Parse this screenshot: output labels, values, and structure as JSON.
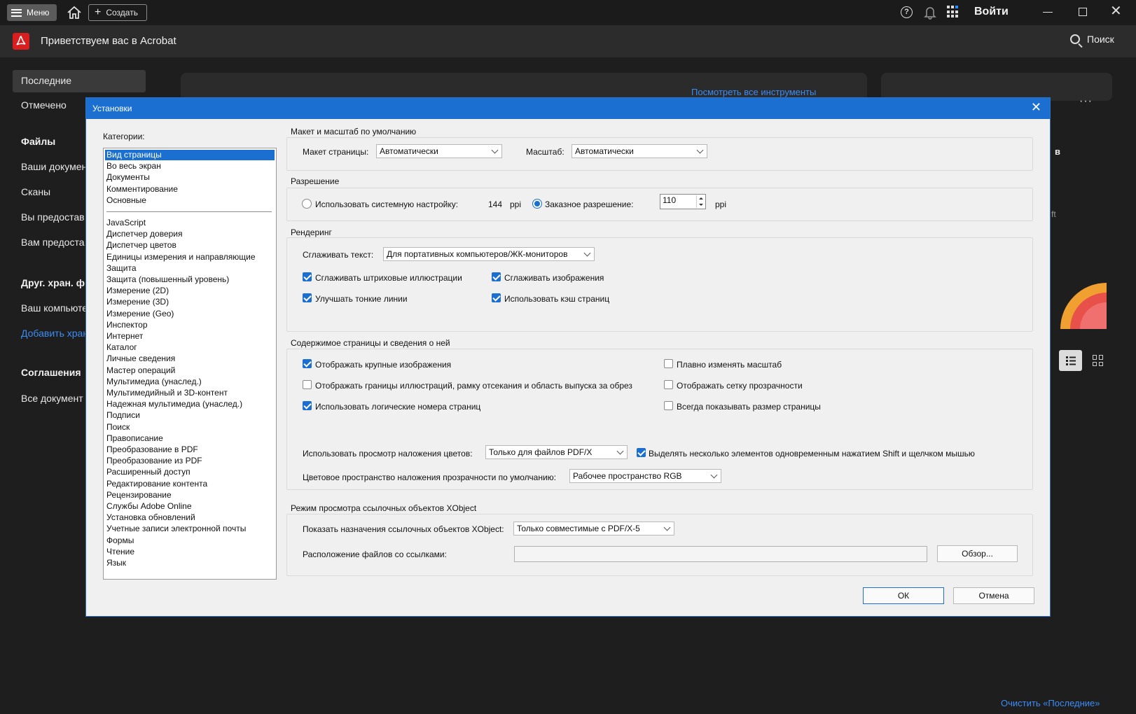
{
  "topbar": {
    "menu_label": "Меню",
    "create_label": "Создать",
    "signin_label": "Войти",
    "icons": [
      "hamburger-icon",
      "home-icon",
      "plus-icon",
      "help-icon",
      "bell-icon",
      "apps-icon",
      "minimize-icon",
      "maximize-icon",
      "close-icon"
    ]
  },
  "header": {
    "title": "Приветствуем вас в Acrobat",
    "search_label": "Поиск"
  },
  "leftnav": {
    "recent": "Последние",
    "starred": "Отмечено",
    "files_heading": "Файлы",
    "files_items": [
      "Ваши докумен",
      "Сканы",
      "Вы предостав",
      "Вам предоста"
    ],
    "other_heading": "Друг. хран. ф",
    "computer": "Ваш компьюте",
    "add_storage": "Добавить хран",
    "agreements_heading": "Соглашения",
    "all_documents": "Все документ"
  },
  "background": {
    "tools_link": "Посмотреть все инструменты",
    "more": "···",
    "letter_b": "в",
    "ft_text": "ft",
    "clear_recent": "Очистить «Последние»"
  },
  "dialog": {
    "title": "Установки",
    "categories_label": "Категории:",
    "categories_top": [
      "Вид страницы",
      "Во весь экран",
      "Документы",
      "Комментирование",
      "Основные"
    ],
    "categories_bottom": [
      "JavaScript",
      "Диспетчер доверия",
      "Диспетчер цветов",
      "Единицы измерения и направляющие",
      "Защита",
      "Защита (повышенный уровень)",
      "Измерение (2D)",
      "Измерение (3D)",
      "Измерение (Geo)",
      "Инспектор",
      "Интернет",
      "Каталог",
      "Личные сведения",
      "Мастер операций",
      "Мультимедиа (унаслед.)",
      "Мультимедийный и 3D-контент",
      "Надежная мультимедиа (унаслед.)",
      "Подписи",
      "Поиск",
      "Правописание",
      "Преобразование в PDF",
      "Преобразование из PDF",
      "Расширенный доступ",
      "Редактирование контента",
      "Рецензирование",
      "Службы Adobe Online",
      "Установка обновлений",
      "Учетные записи электронной почты",
      "Формы",
      "Чтение",
      "Язык"
    ],
    "selected_category": "Вид страницы",
    "layout": {
      "title": "Макет и масштаб по умолчанию",
      "page_layout_label": "Макет страницы:",
      "page_layout_value": "Автоматически",
      "zoom_label": "Масштаб:",
      "zoom_value": "Автоматически"
    },
    "resolution": {
      "title": "Разрешение",
      "system_label": "Использовать системную настройку:",
      "system_value": "144",
      "system_unit": "ppi",
      "custom_label": "Заказное разрешение:",
      "custom_value": "110",
      "custom_unit": "ppi",
      "system_selected": false,
      "custom_selected": true
    },
    "rendering": {
      "title": "Рендеринг",
      "smooth_text_label": "Сглаживать текст:",
      "smooth_text_value": "Для портативных компьютеров/ЖК-мониторов",
      "smooth_line_art": "Сглаживать штриховые иллюстрации",
      "smooth_images": "Сглаживать изображения",
      "enhance_thin_lines": "Улучшать тонкие линии",
      "use_page_cache": "Использовать кэш страниц",
      "smooth_line_art_checked": true,
      "smooth_images_checked": true,
      "enhance_thin_lines_checked": true,
      "use_page_cache_checked": true
    },
    "content": {
      "title": "Содержимое страницы и сведения о ней",
      "show_large_images": "Отображать крупные изображения",
      "show_art_boxes": "Отображать границы иллюстраций, рамку отсекания и область выпуска за обрез",
      "use_logical_page_numbers": "Использовать логические номера страниц",
      "smooth_zoom": "Плавно изменять масштаб",
      "show_transparency_grid": "Отображать сетку прозрачности",
      "always_show_page_size": "Всегда показывать размер страницы",
      "show_large_images_checked": true,
      "show_art_boxes_checked": false,
      "use_logical_page_numbers_checked": true,
      "smooth_zoom_checked": false,
      "show_transparency_grid_checked": false,
      "always_show_page_size_checked": false,
      "overprint_label": "Использовать просмотр наложения цветов:",
      "overprint_value": "Только для файлов PDF/X",
      "shift_select": "Выделять несколько элементов одновременным нажатием Shift и щелчком мышью",
      "shift_select_checked": true,
      "blend_space_label": "Цветовое пространство наложения прозрачности по умолчанию:",
      "blend_space_value": "Рабочее пространство RGB"
    },
    "xobject": {
      "title": "Режим просмотра ссылочных объектов XObject",
      "show_targets_label": "Показать назначения ссылочных объектов XObject:",
      "show_targets_value": "Только совместимые с PDF/X-5",
      "location_label": "Расположение файлов со ссылками:",
      "location_value": "",
      "browse_label": "Обзор..."
    },
    "ok_label": "ОК",
    "cancel_label": "Отмена"
  },
  "colors": {
    "accent": "#1a6fd1",
    "link": "#3d8cf5",
    "app_bg": "#1e1e1e",
    "acrobat_red": "#d81e1e"
  }
}
